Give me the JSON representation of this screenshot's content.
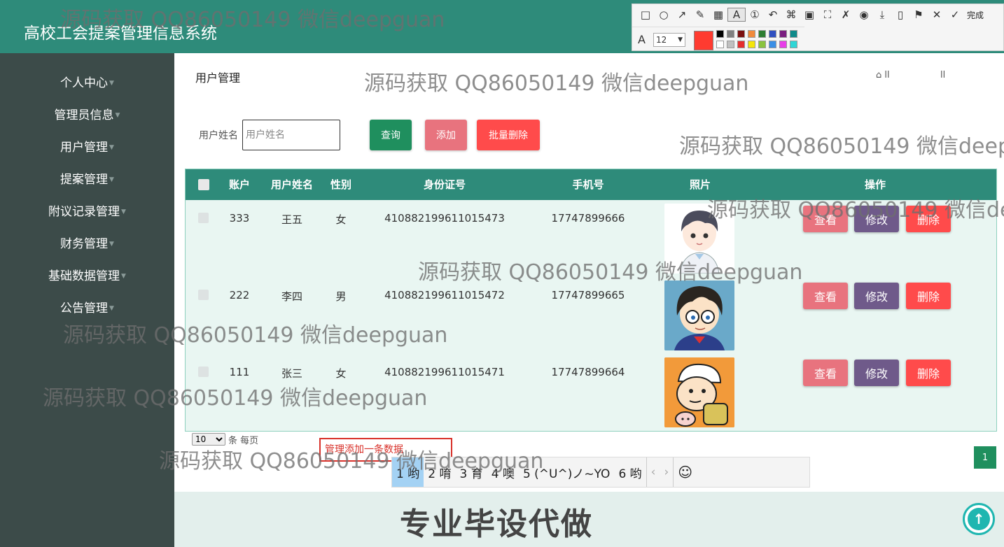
{
  "app": {
    "title": "高校工会提案管理信息系统"
  },
  "sidebar": {
    "items": [
      {
        "label": "个人中心"
      },
      {
        "label": "管理员信息"
      },
      {
        "label": "用户管理"
      },
      {
        "label": "提案管理"
      },
      {
        "label": "附议记录管理"
      },
      {
        "label": "财务管理"
      },
      {
        "label": "基础数据管理"
      },
      {
        "label": "公告管理"
      }
    ]
  },
  "main": {
    "title": "用户管理",
    "breadcrumb": {
      "home_icon": "home-icon",
      "sep1": "ll",
      "sep2": "ll"
    },
    "search": {
      "label": "用户姓名",
      "placeholder": "用户姓名",
      "query_button": "查询",
      "add_button": "添加",
      "batch_delete_button": "批量删除"
    }
  },
  "table": {
    "columns": [
      "账户",
      "用户姓名",
      "性别",
      "身份证号",
      "手机号",
      "照片",
      "操作"
    ],
    "rows": [
      {
        "account": "333",
        "name": "王五",
        "gender": "女",
        "id_number": "410882199611015473",
        "phone": "17747899666"
      },
      {
        "account": "222",
        "name": "李四",
        "gender": "男",
        "id_number": "410882199611015472",
        "phone": "17747899665"
      },
      {
        "account": "111",
        "name": "张三",
        "gender": "女",
        "id_number": "410882199611015471",
        "phone": "17747899664"
      }
    ],
    "actions": {
      "view": "查看",
      "edit": "修改",
      "delete": "删除"
    }
  },
  "pagination": {
    "page_size": "10",
    "per_page_label": "条 每页",
    "current_page": "1"
  },
  "tooltip": {
    "text": "管理添加一条数据"
  },
  "ime": {
    "candidates": [
      "1 哟",
      "2 唷",
      "3 育",
      "4 噢",
      "5 (^U^)ノ~YO",
      "6 哟"
    ],
    "prev": "‹",
    "next": "›",
    "emoji": "☺"
  },
  "footer": {
    "text": "专业毕设代做"
  },
  "toolbar": {
    "font_icon": "A",
    "font_size": "12",
    "done": "完成"
  },
  "watermark": {
    "text": "源码获取 QQ86050149 微信deepguan",
    "text_partial": "源码获取 QQ86050149 微信deep",
    "text_partial2": "源码获取 QQ86050149 微信de"
  },
  "colors": {
    "header": "#2e8b7a",
    "sidebar": "#3c4b49",
    "query": "#1f8f5e",
    "add": "#e8737e",
    "batch_delete": "#ff4b4b",
    "view": "#e8737e",
    "edit": "#6f5a8a",
    "delete": "#ff4b4b"
  }
}
